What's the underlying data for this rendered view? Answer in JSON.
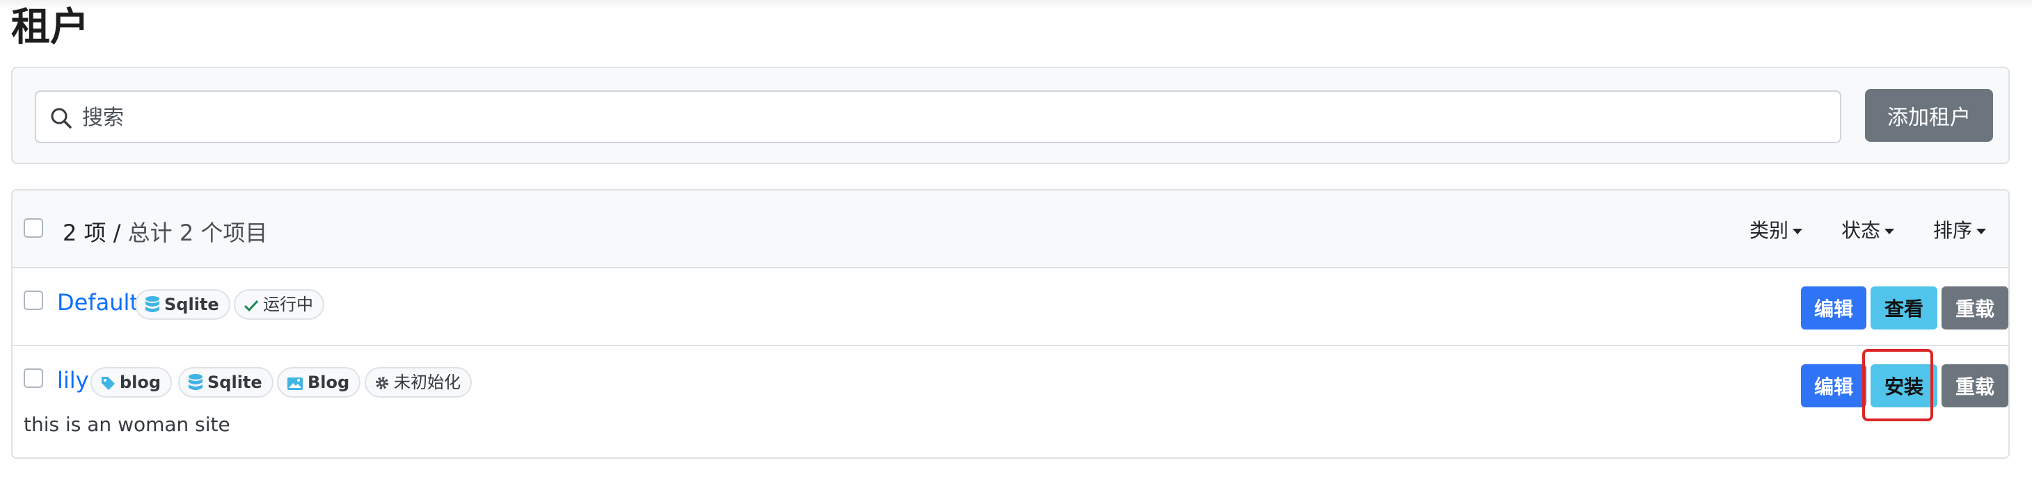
{
  "page": {
    "title": "租户"
  },
  "search": {
    "placeholder": "搜索"
  },
  "toolbar": {
    "add_label": "添加租户"
  },
  "list": {
    "count_label": "2 项",
    "separator": "/",
    "total_label": "总计 2 个项目",
    "filters": {
      "category": "类别",
      "status": "状态",
      "sort": "排序"
    }
  },
  "tenants": [
    {
      "name": "Default",
      "badges": {
        "database": "Sqlite",
        "status": "运行中"
      },
      "actions": {
        "edit": "编辑",
        "view": "查看",
        "reload": "重载"
      }
    },
    {
      "name": "lily",
      "badges": {
        "tag": "blog",
        "database": "Sqlite",
        "theme": "Blog",
        "status": "未初始化"
      },
      "description": "this is an woman site",
      "actions": {
        "edit": "编辑",
        "install": "安装",
        "reload": "重载"
      }
    }
  ],
  "colors": {
    "primary": "#2f74f5",
    "info": "#50c4ea",
    "secondary": "#6c757d",
    "link": "#0d6efd",
    "highlight": "#dc2626",
    "running": "#198754"
  },
  "icons": [
    "search-icon",
    "database-icon",
    "check-icon",
    "tag-icon",
    "image-icon",
    "gear-icon",
    "caret-down-icon"
  ]
}
